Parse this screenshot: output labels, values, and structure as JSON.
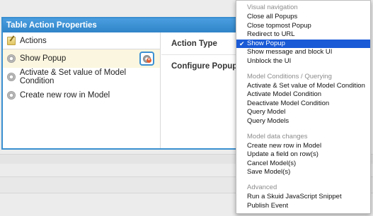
{
  "panel": {
    "title": "Table Action Properties"
  },
  "left_list": {
    "header": "Actions",
    "items": [
      {
        "label": "Show Popup",
        "selected": true
      },
      {
        "label": "Activate & Set value of Model Condition",
        "selected": false
      },
      {
        "label": "Create new row in Model",
        "selected": false
      }
    ]
  },
  "properties": {
    "action_type_label": "Action Type",
    "configure_popup_label": "Configure Popup"
  },
  "menu": {
    "check_glyph": "✔",
    "groups": [
      {
        "title": "Visual navigation",
        "items": [
          "Close all Popups",
          "Close topmost Popup",
          "Redirect to URL",
          "Show Popup",
          "Show message and block UI",
          "Unblock the UI"
        ]
      },
      {
        "title": "Model Conditions / Querying",
        "items": [
          "Activate & Set value of Model Condition",
          "Activate Model Condition",
          "Deactivate Model Condition",
          "Query Model",
          "Query Models"
        ]
      },
      {
        "title": "Model data changes",
        "items": [
          "Create new row in Model",
          "Update a field on row(s)",
          "Cancel Model(s)",
          "Save Model(s)"
        ]
      },
      {
        "title": "Advanced",
        "items": [
          "Run a Skuid JavaScript Snippet",
          "Publish Event"
        ]
      }
    ],
    "selected": "Show Popup"
  }
}
